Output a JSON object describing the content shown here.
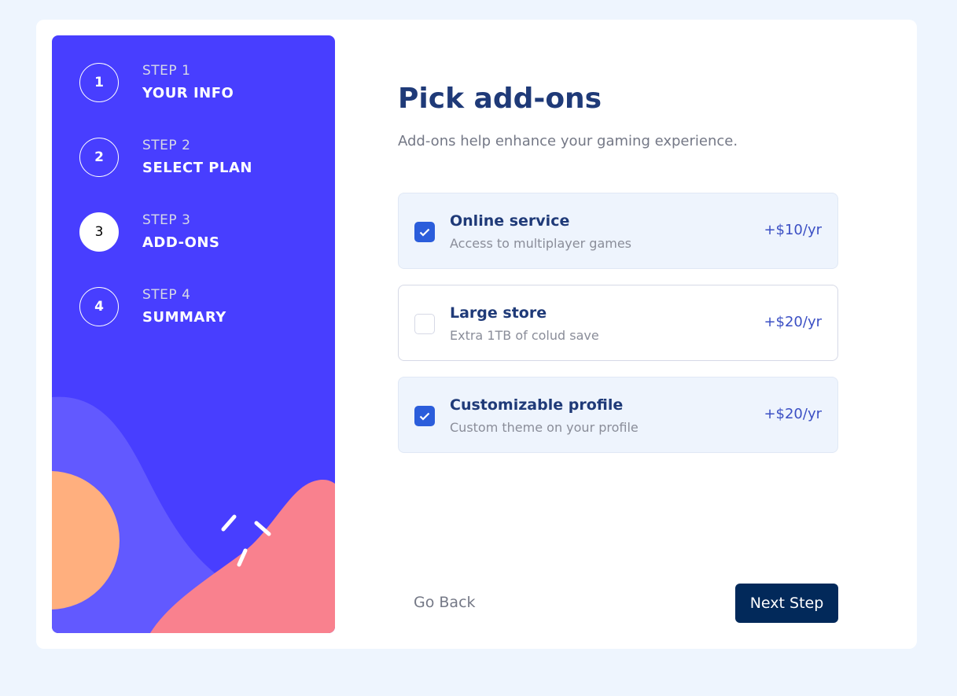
{
  "sidebar": {
    "steps": [
      {
        "number": "1",
        "kicker": "STEP 1",
        "title": "YOUR INFO",
        "active": false
      },
      {
        "number": "2",
        "kicker": "STEP 2",
        "title": "SELECT PLAN",
        "active": false
      },
      {
        "number": "3",
        "kicker": "STEP 3",
        "title": "ADD-ONS",
        "active": true
      },
      {
        "number": "4",
        "kicker": "STEP 4",
        "title": "SUMMARY",
        "active": false
      }
    ]
  },
  "main": {
    "title": "Pick add-ons",
    "subtitle": "Add-ons help enhance your gaming experience.",
    "addons": [
      {
        "name": "Online service",
        "description": "Access to multiplayer games",
        "price": "+$10/yr",
        "checked": true
      },
      {
        "name": "Large store",
        "description": "Extra 1TB of colud save",
        "price": "+$20/yr",
        "checked": false
      },
      {
        "name": "Customizable profile",
        "description": "Custom theme on your profile",
        "price": "+$20/yr",
        "checked": true
      }
    ]
  },
  "footer": {
    "back_label": "Go Back",
    "next_label": "Next Step"
  },
  "colors": {
    "sidebar_bg": "#483eff",
    "accent": "#2b5ddb",
    "title": "#1f3a78",
    "next_button": "#02295a",
    "page_bg": "#eef5fe"
  }
}
